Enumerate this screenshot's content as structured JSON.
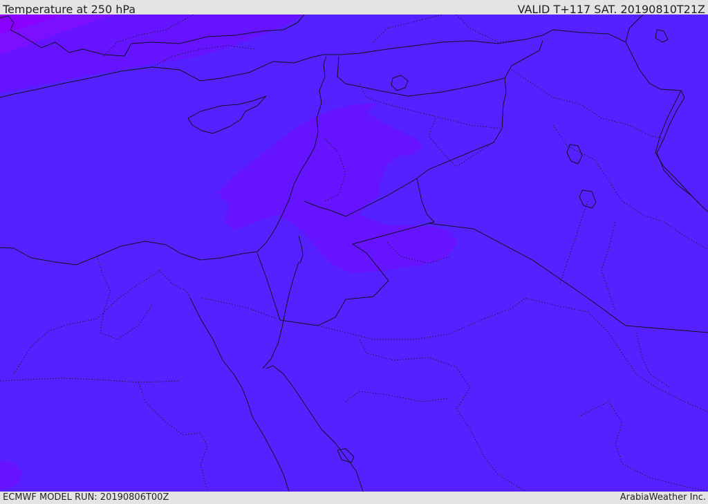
{
  "header": {
    "title": "Temperature at 250 hPa",
    "valid": "VALID T+117 SAT. 20190810T21Z"
  },
  "footer": {
    "model_run": "ECMWF MODEL RUN: 20190806T00Z",
    "credit": "ArabiaWeather Inc."
  },
  "map": {
    "field": "temperature",
    "level": "250 hPa",
    "colors": {
      "base": "#5522ff",
      "warm_band": "#6614ff",
      "warmer": "#7a10ff",
      "warmest": "#8a00ff",
      "coast": "#111122"
    }
  }
}
